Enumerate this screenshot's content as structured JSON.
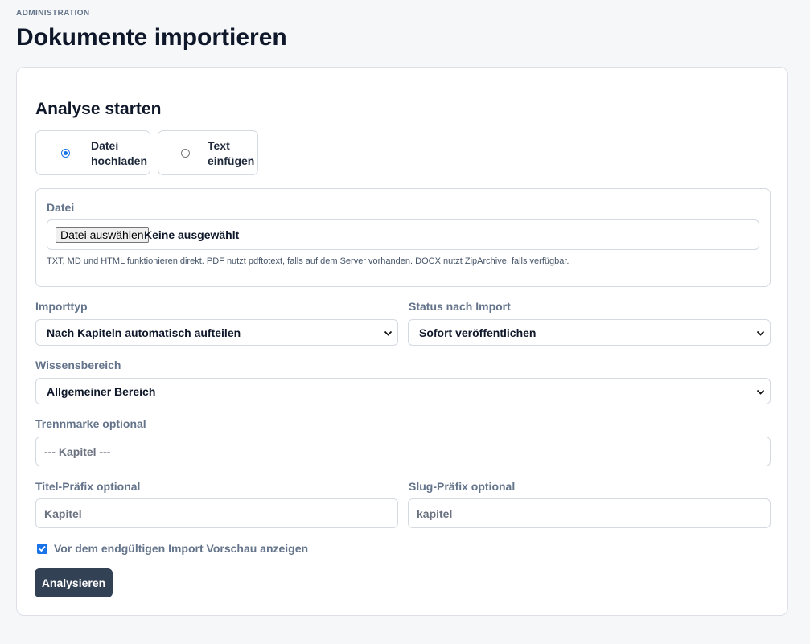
{
  "header": {
    "eyebrow": "ADMINISTRATION",
    "title": "Dokumente importieren"
  },
  "form": {
    "section_title": "Analyse starten",
    "modes": [
      {
        "label": "Datei hochladen",
        "selected": true
      },
      {
        "label": "Text einfügen",
        "selected": false
      }
    ],
    "file": {
      "label": "Datei",
      "button_label": "Datei auswählen",
      "status": "Keine ausgewählt",
      "hint": "TXT, MD und HTML funktionieren direkt. PDF nutzt pdftotext, falls auf dem Server vorhanden. DOCX nutzt ZipArchive, falls verfügbar."
    },
    "import_type": {
      "label": "Importtyp",
      "value": "Nach Kapiteln automatisch aufteilen"
    },
    "status_after": {
      "label": "Status nach Import",
      "value": "Sofort veröffentlichen"
    },
    "knowledge_area": {
      "label": "Wissensbereich",
      "value": "Allgemeiner Bereich"
    },
    "separator": {
      "label": "Trennmarke optional",
      "placeholder": "--- Kapitel ---"
    },
    "title_prefix": {
      "label": "Titel-Präfix optional",
      "placeholder": "Kapitel"
    },
    "slug_prefix": {
      "label": "Slug-Präfix optional",
      "placeholder": "kapitel"
    },
    "preview": {
      "label": "Vor dem endgültigen Import Vorschau anzeigen",
      "checked": true
    },
    "submit_label": "Analysieren"
  },
  "colors": {
    "accent": "#1a73e8",
    "button_bg": "#334155",
    "label": "#64748b",
    "border": "#d5dae1"
  }
}
